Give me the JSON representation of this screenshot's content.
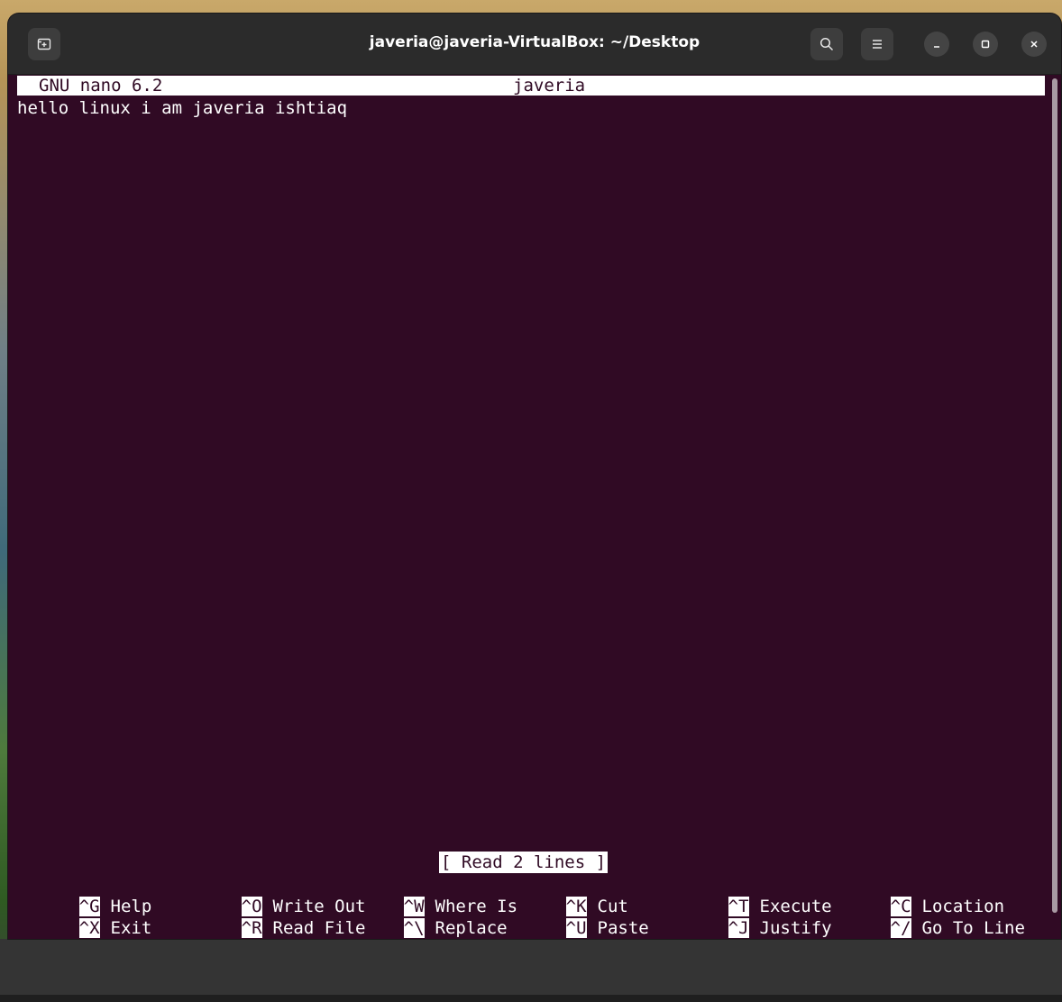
{
  "window": {
    "title": "javeria@javeria-VirtualBox: ~/Desktop"
  },
  "icons": {
    "new_tab": "new-tab-icon",
    "search": "search-icon",
    "menu": "hamburger-menu-icon",
    "minimize": "minimize-icon",
    "maximize": "maximize-icon",
    "close": "close-icon"
  },
  "nano": {
    "version_label": "GNU nano 6.2",
    "filename": "javeria",
    "content_lines": [
      "hello linux i am javeria ishtiaq"
    ],
    "status_message": "[ Read 2 lines ]",
    "shortcuts_row1": [
      {
        "key": "^G",
        "label": "Help"
      },
      {
        "key": "^O",
        "label": "Write Out"
      },
      {
        "key": "^W",
        "label": "Where Is"
      },
      {
        "key": "^K",
        "label": "Cut"
      },
      {
        "key": "^T",
        "label": "Execute"
      },
      {
        "key": "^C",
        "label": "Location"
      }
    ],
    "shortcuts_row2": [
      {
        "key": "^X",
        "label": "Exit"
      },
      {
        "key": "^R",
        "label": "Read File"
      },
      {
        "key": "^\\",
        "label": "Replace"
      },
      {
        "key": "^U",
        "label": "Paste"
      },
      {
        "key": "^J",
        "label": "Justify"
      },
      {
        "key": "^/",
        "label": "Go To Line"
      }
    ]
  },
  "colors": {
    "terminal_bg": "#300a24",
    "terminal_fg": "#ffffff",
    "titlebar_bg": "#2b2b2b"
  }
}
